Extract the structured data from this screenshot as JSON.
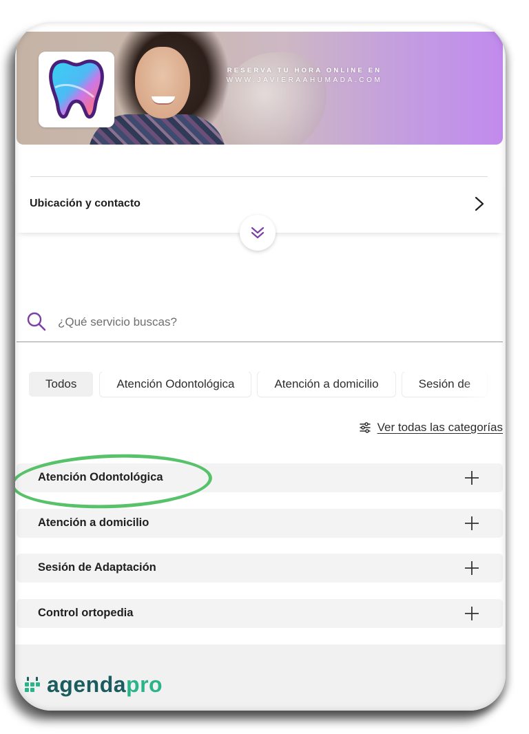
{
  "banner": {
    "promo_line1": "RESERVA TU HORA ONLINE EN",
    "promo_line2": "WWW.JAVIERAAHUMADA.COM"
  },
  "location": {
    "label": "Ubicación y contacto"
  },
  "search": {
    "placeholder": "¿Qué servicio buscas?"
  },
  "chips": [
    {
      "label": "Todos",
      "active": true
    },
    {
      "label": "Atención Odontológica",
      "active": false
    },
    {
      "label": "Atención a domicilio",
      "active": false
    },
    {
      "label": "Sesión de",
      "active": false
    }
  ],
  "categories_link": {
    "label": "Ver todas las categorías"
  },
  "services": [
    {
      "label": "Atención Odontológica"
    },
    {
      "label": "Atención a domicilio"
    },
    {
      "label": "Sesión de Adaptación"
    },
    {
      "label": "Control ortopedia"
    }
  ],
  "footer": {
    "brand_part1": "agenda",
    "brand_part2": "pro"
  },
  "colors": {
    "accent_purple": "#7b3fa8",
    "highlight_green": "#57c26a",
    "brand_dark": "#1b5c5e",
    "brand_green": "#2bb48a"
  },
  "icons": [
    "tooth-logo-icon",
    "chevron-right-icon",
    "double-chevron-down-icon",
    "search-icon",
    "sliders-icon",
    "plus-icon"
  ]
}
